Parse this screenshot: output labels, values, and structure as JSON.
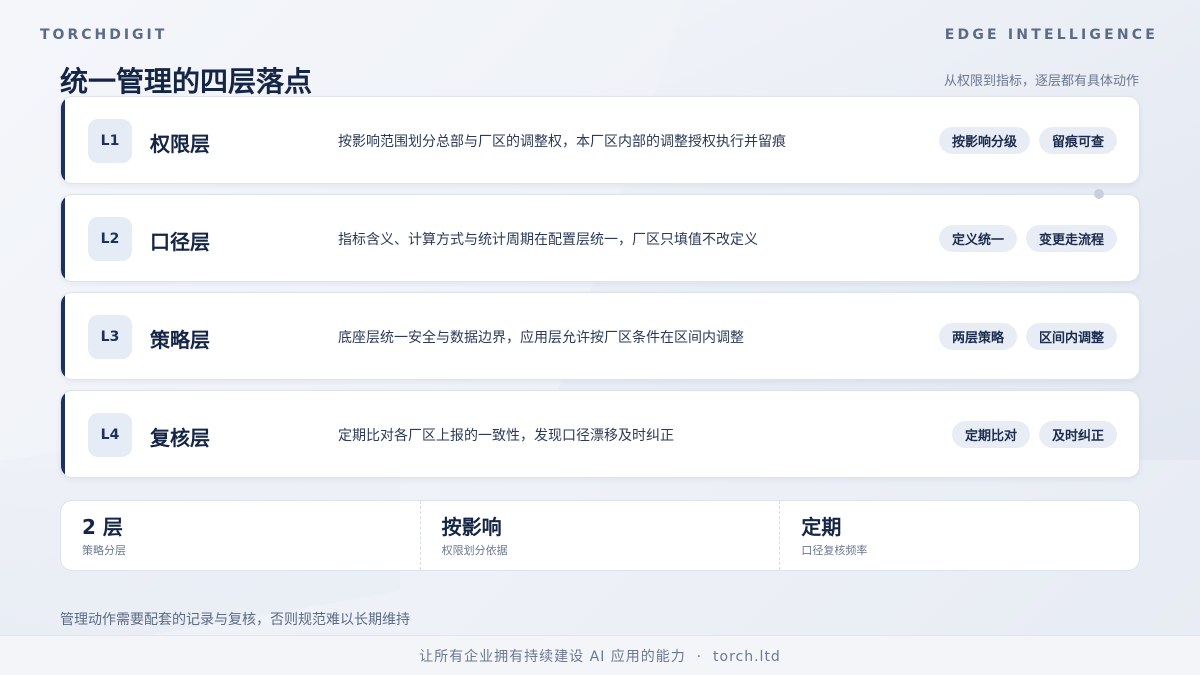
{
  "brand": "TORCHDIGIT",
  "tagline": "EDGE INTELLIGENCE",
  "title": "统一管理的四层落点",
  "subtitle": "从权限到指标，逐层都有具体动作",
  "layers": [
    {
      "level": "L1",
      "name": "权限层",
      "description": "按影响范围划分总部与厂区的调整权，本厂区内部的调整授权执行并留痕",
      "tags": [
        "按影响分级",
        "留痕可查"
      ]
    },
    {
      "level": "L2",
      "name": "口径层",
      "description": "指标含义、计算方式与统计周期在配置层统一，厂区只填值不改定义",
      "tags": [
        "定义统一",
        "变更走流程"
      ]
    },
    {
      "level": "L3",
      "name": "策略层",
      "description": "底座层统一安全与数据边界，应用层允许按厂区条件在区间内调整",
      "tags": [
        "两层策略",
        "区间内调整"
      ]
    },
    {
      "level": "L4",
      "name": "复核层",
      "description": "定期比对各厂区上报的一致性，发现口径漂移及时纠正",
      "tags": [
        "定期比对",
        "及时纠正"
      ]
    }
  ],
  "stats": [
    {
      "value": "2 层",
      "label": "策略分层"
    },
    {
      "value": "按影响",
      "label": "权限划分依据"
    },
    {
      "value": "定期",
      "label": "口径复核频率"
    }
  ],
  "note": "管理动作需要配套的记录与复核，否则规范难以长期维持",
  "footer": "让所有企业拥有持续建设 AI 应用的能力  ·  torch.ltd"
}
